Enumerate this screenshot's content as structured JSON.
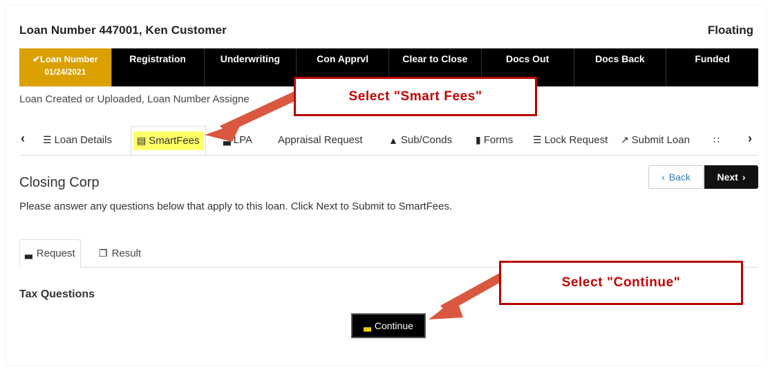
{
  "header": {
    "title": "Loan Number 447001, Ken Customer",
    "status": "Floating"
  },
  "steps": [
    {
      "label": "✔Loan Number",
      "date": "01/24/2021",
      "active": true
    },
    {
      "label": "Registration"
    },
    {
      "label": "Underwriting"
    },
    {
      "label": "Con Apprvl"
    },
    {
      "label": "Clear to Close"
    },
    {
      "label": "Docs Out"
    },
    {
      "label": "Docs Back"
    },
    {
      "label": "Funded"
    }
  ],
  "status_text": "Loan Created or Uploaded, Loan Number Assigne",
  "tabs": [
    {
      "label": "Loan Details",
      "icon": "list-icon"
    },
    {
      "label": "SmartFees",
      "icon": "calculator-icon"
    },
    {
      "label": "LPA",
      "icon": "gavel-icon"
    },
    {
      "label": "Appraisal Request",
      "icon": ""
    },
    {
      "label": "Sub/Conds",
      "icon": "folder-icon"
    },
    {
      "label": "Forms",
      "icon": "book-icon"
    },
    {
      "label": "Lock Request",
      "icon": "list-icon"
    },
    {
      "label": "Submit Loan",
      "icon": "share-icon"
    }
  ],
  "section": {
    "title": "Closing Corp",
    "back_label": "Back",
    "next_label": "Next",
    "description": "Please answer any questions below that apply to this loan.  Click Next to Submit to SmartFees."
  },
  "subtabs": [
    {
      "label": "Request",
      "icon": "gavel-icon"
    },
    {
      "label": "Result",
      "icon": "copy-icon"
    }
  ],
  "questions": {
    "title": "Tax Questions",
    "continue_label": "Continue"
  },
  "annotations": {
    "callout1": "Select \"Smart Fees\"",
    "callout2": "Select \"Continue\"",
    "color": "#b80000"
  }
}
